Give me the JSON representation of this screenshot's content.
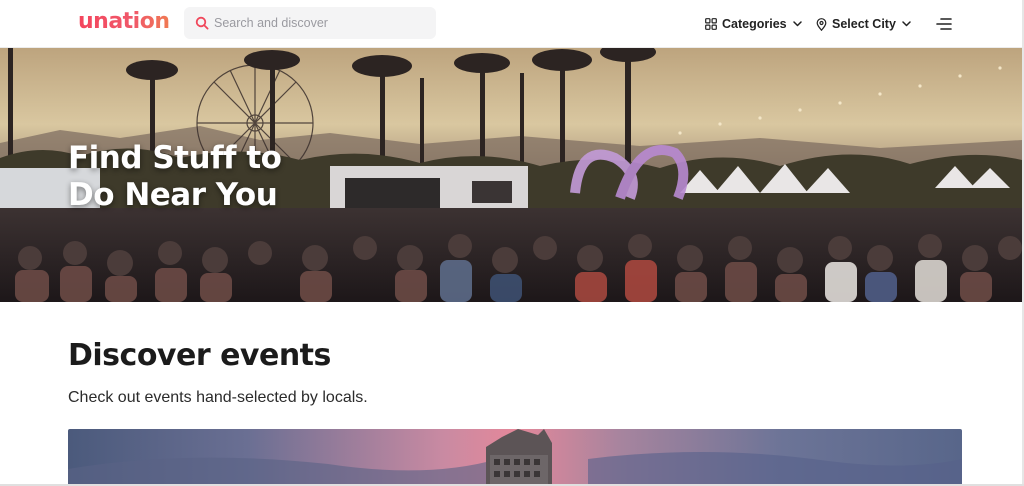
{
  "header": {
    "logo": "unation",
    "search": {
      "placeholder": "Search and discover",
      "value": ""
    },
    "nav": {
      "categories_label": "Categories",
      "city_label": "Select City"
    },
    "icons": [
      "search-icon",
      "grid-icon",
      "chevron-down-icon",
      "location-pin-icon",
      "menu-icon"
    ],
    "accent_color": "#f0475b"
  },
  "hero": {
    "title": "Find Stuff to Do Near You"
  },
  "discover": {
    "title": "Discover events",
    "subtitle": "Check out events hand-selected by locals."
  }
}
